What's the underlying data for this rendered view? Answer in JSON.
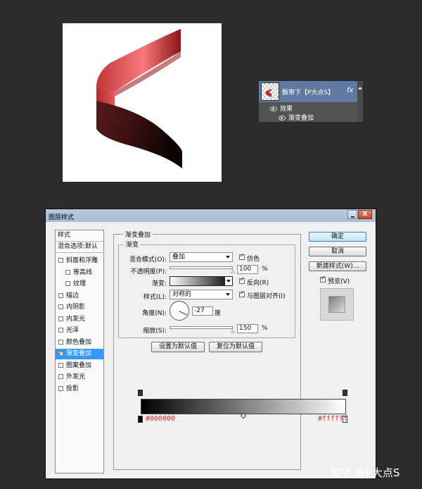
{
  "layers_panel": {
    "layer_name": "飘带下【P大点S】",
    "fx_label": "fx",
    "effects_label": "效果",
    "effect_item": "渐变叠加"
  },
  "dialog": {
    "title": "图层样式",
    "close_label": "X",
    "styles_header": "样式",
    "blend_options": "混合选项:默认",
    "style_items": [
      {
        "label": "斜面和浮雕",
        "checked": false,
        "sub": false,
        "active": false
      },
      {
        "label": "等高线",
        "checked": false,
        "sub": true,
        "active": false
      },
      {
        "label": "纹理",
        "checked": false,
        "sub": true,
        "active": false
      },
      {
        "label": "描边",
        "checked": false,
        "sub": false,
        "active": false
      },
      {
        "label": "内阴影",
        "checked": false,
        "sub": false,
        "active": false
      },
      {
        "label": "内发光",
        "checked": false,
        "sub": false,
        "active": false
      },
      {
        "label": "光泽",
        "checked": false,
        "sub": false,
        "active": false
      },
      {
        "label": "颜色叠加",
        "checked": false,
        "sub": false,
        "active": false
      },
      {
        "label": "渐变叠加",
        "checked": true,
        "sub": false,
        "active": true
      },
      {
        "label": "图案叠加",
        "checked": false,
        "sub": false,
        "active": false
      },
      {
        "label": "外发光",
        "checked": false,
        "sub": false,
        "active": false
      },
      {
        "label": "投影",
        "checked": false,
        "sub": false,
        "active": false
      }
    ],
    "section_title": "渐变叠加",
    "subsection_title": "渐变",
    "blend_mode_label": "混合模式(O):",
    "blend_mode_value": "叠加",
    "dither_label": "仿色",
    "dither_checked": true,
    "opacity_label": "不透明度(P):",
    "opacity_value": "100",
    "opacity_percent": 1.0,
    "percent_sign": "%",
    "gradient_label": "渐变:",
    "reverse_label": "反向(R)",
    "reverse_checked": true,
    "style_label": "样式(L):",
    "style_value": "对称的",
    "align_label": "与图层对齐(I)",
    "align_checked": true,
    "angle_label": "角度(N):",
    "angle_value": "-27",
    "angle_unit": "度",
    "scale_label": "缩放(S):",
    "scale_value": "150",
    "scale_percent": 1.0,
    "set_default_button": "设置为默认值",
    "reset_default_button": "复位为默认值",
    "ok_button": "确定",
    "cancel_button": "取消",
    "new_style_button": "新建样式(W)...",
    "preview_label": "预览(V)",
    "preview_checked": true,
    "gradient_start_hex": "#000000",
    "gradient_end_hex": "#ffffff"
  },
  "colors": {
    "ribbon_red": "#e34b4f",
    "ribbon_dark": "#2a0b0c",
    "accent_blue": "#3399ff",
    "hex_text": "#d42b2b"
  },
  "watermark": "知乎 @P大点S"
}
